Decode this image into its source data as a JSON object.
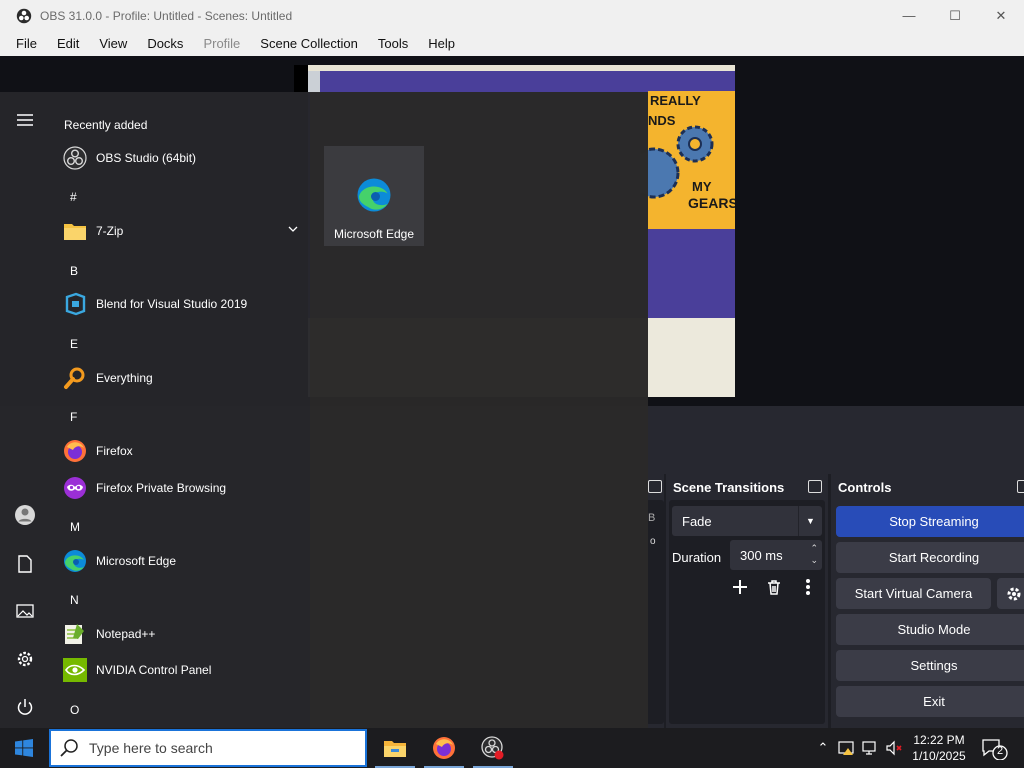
{
  "obs": {
    "window_title": "OBS 31.0.0 - Profile: Untitled - Scenes: Untitled",
    "menu": [
      "File",
      "Edit",
      "View",
      "Docks",
      "Profile",
      "Scene Collection",
      "Tools",
      "Help"
    ],
    "preview_sign_text": [
      "REALLY",
      "NDS",
      "MY",
      "GEARS"
    ],
    "transitions": {
      "title": "Scene Transitions",
      "transition_value": "Fade",
      "duration_label": "Duration",
      "duration_value": "300 ms"
    },
    "controls": {
      "title": "Controls",
      "buttons": [
        "Stop Streaming",
        "Start Recording",
        "Start Virtual Camera",
        "Studio Mode",
        "Settings",
        "Exit"
      ]
    },
    "partial_dock_letters": [
      "B",
      "o"
    ],
    "colors": {
      "primary_button": "#284cb8",
      "dock_bg": "#272830"
    }
  },
  "start_menu": {
    "recently_added_header": "Recently added",
    "letters": [
      "#",
      "B",
      "E",
      "F",
      "M",
      "N",
      "O"
    ],
    "apps": [
      {
        "label": "OBS Studio (64bit)",
        "icon": "obs-icon"
      },
      {
        "label": "7-Zip",
        "icon": "folder-icon"
      },
      {
        "label": "Blend for Visual Studio 2019",
        "icon": "blend-icon"
      },
      {
        "label": "Everything",
        "icon": "magnifier-icon"
      },
      {
        "label": "Firefox",
        "icon": "firefox-icon"
      },
      {
        "label": "Firefox Private Browsing",
        "icon": "firefox-private-icon"
      },
      {
        "label": "Microsoft Edge",
        "icon": "edge-icon"
      },
      {
        "label": "Notepad++",
        "icon": "notepadpp-icon"
      },
      {
        "label": "NVIDIA Control Panel",
        "icon": "nvidia-icon"
      }
    ],
    "tile": {
      "label": "Microsoft Edge",
      "icon": "edge-icon"
    }
  },
  "taskbar": {
    "search_placeholder": "Type here to search",
    "clock_time": "12:22 PM",
    "clock_date": "1/10/2025",
    "notification_count": "2"
  }
}
